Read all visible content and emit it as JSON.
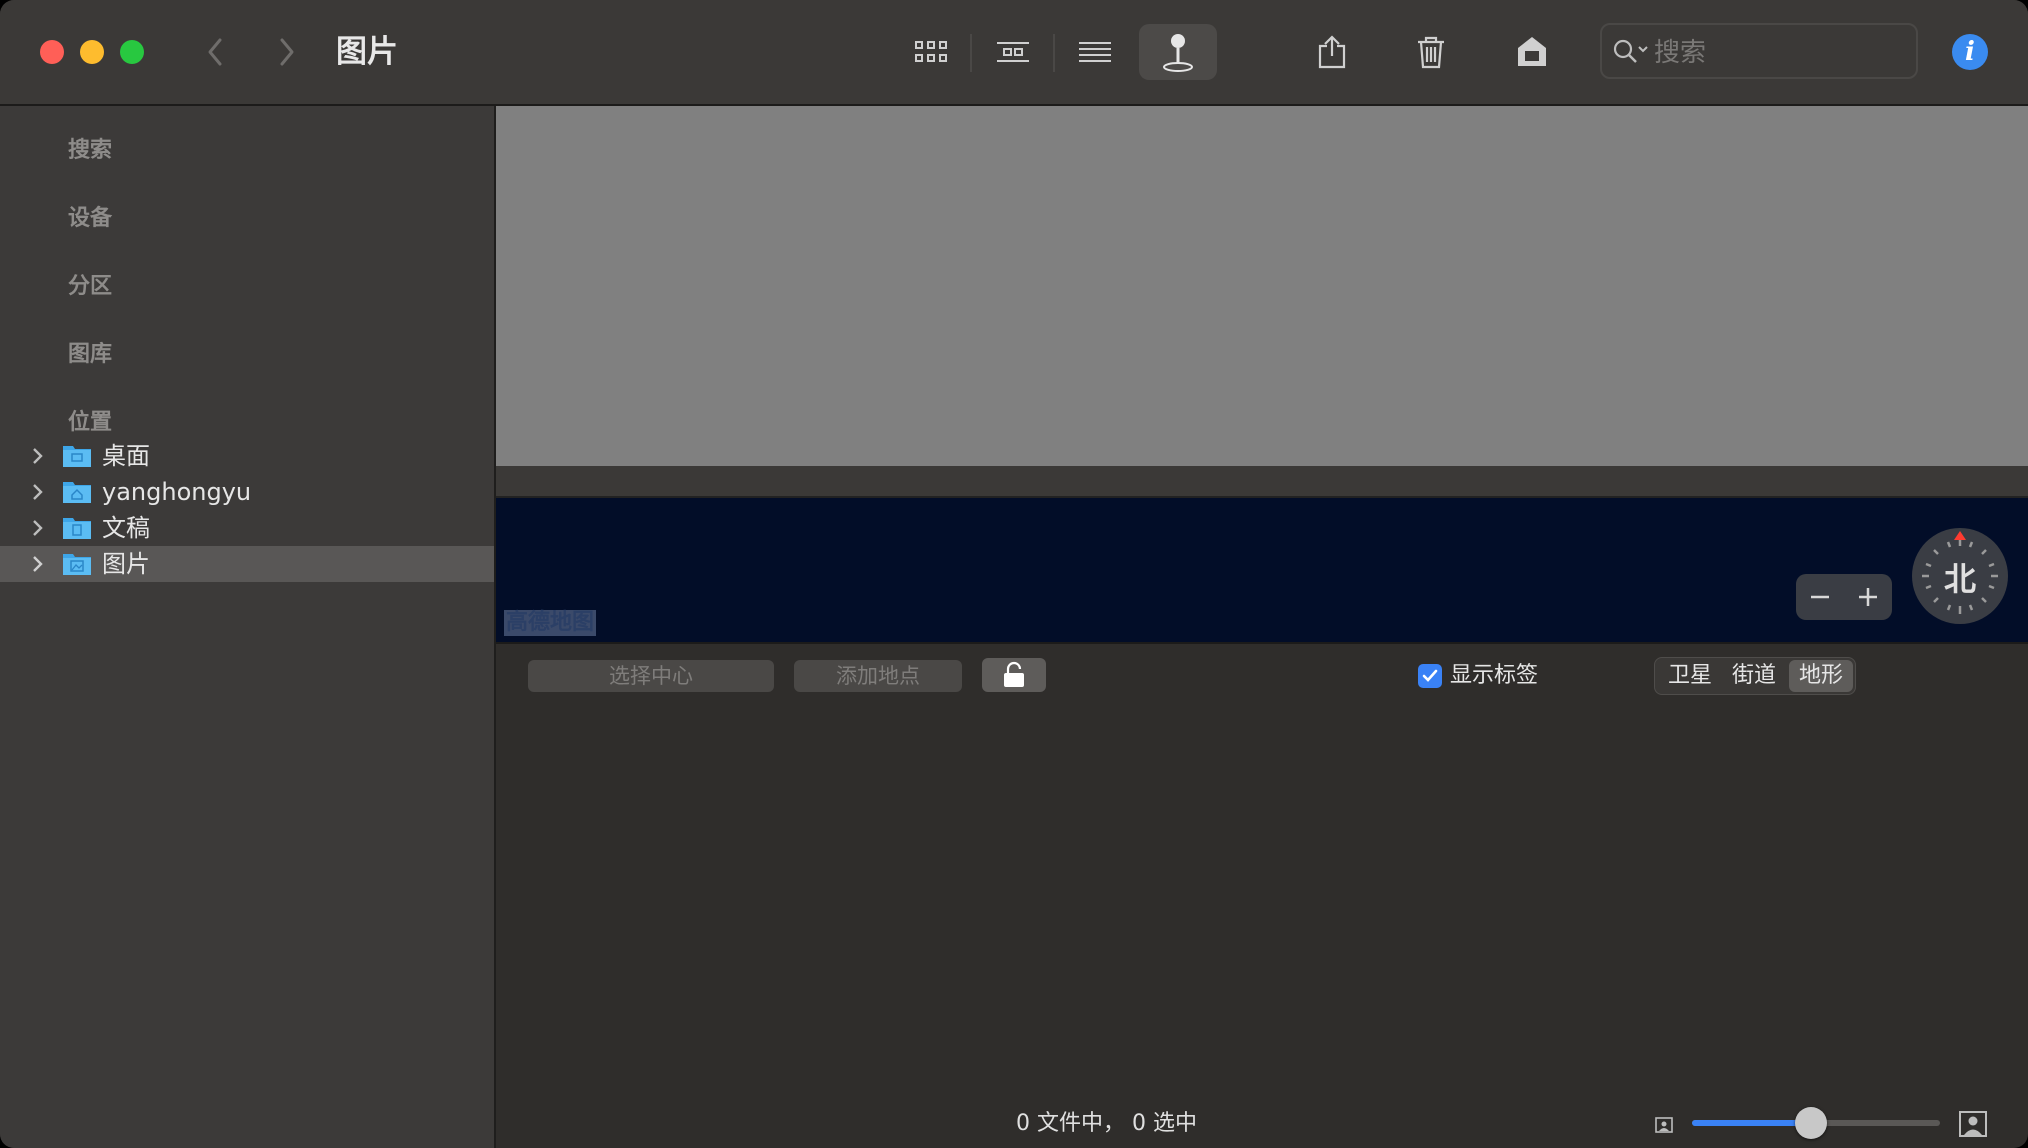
{
  "window": {
    "title": "图片",
    "search_placeholder": "搜索"
  },
  "toolbar": {
    "icons": [
      "grid-view-icon",
      "gallery-view-icon",
      "list-view-icon",
      "map-pin-icon",
      "share-icon",
      "trash-icon",
      "import-icon"
    ],
    "active_view": "map"
  },
  "sidebar": {
    "sections": [
      "搜索",
      "设备",
      "分区",
      "图库",
      "位置"
    ],
    "items": [
      {
        "label": "桌面",
        "icon": "desktop-folder-icon"
      },
      {
        "label": "yanghongyu",
        "icon": "home-folder-icon"
      },
      {
        "label": "文稿",
        "icon": "documents-folder-icon"
      },
      {
        "label": "图片",
        "icon": "pictures-folder-icon",
        "selected": true
      }
    ]
  },
  "map": {
    "attribution": "高德地图",
    "compass_label": "北"
  },
  "controls": {
    "select_center": "选择中心",
    "add_location": "添加地点",
    "show_labels": "显示标签",
    "show_labels_checked": true,
    "map_modes": [
      "卫星",
      "街道",
      "地形"
    ],
    "active_mode": "地形"
  },
  "status": {
    "text": "0 文件中，  0 选中",
    "thumbnail_size": 0.48
  },
  "colors": {
    "accent": "#3a82f6",
    "map_background": "#020d28",
    "preview_gray": "#808080",
    "close": "#ff5f57",
    "minimize": "#febc2e",
    "maximize": "#28c840"
  }
}
